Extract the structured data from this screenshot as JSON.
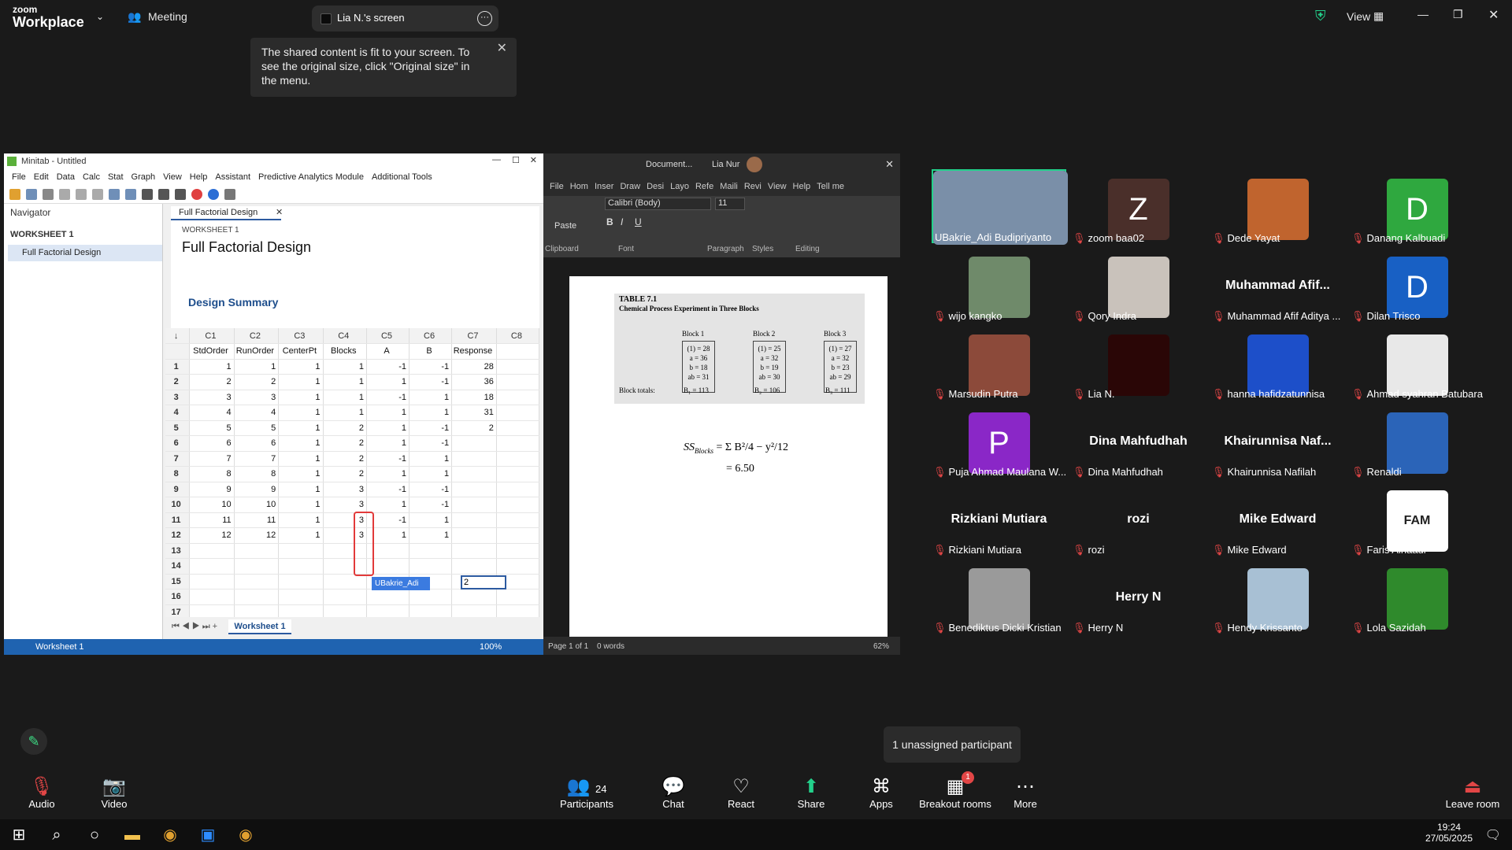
{
  "zoom": {
    "brand_top": "zoom",
    "brand": "Workplace",
    "meeting": "Meeting",
    "view": "View",
    "share_title": "Lia N.'s screen",
    "notice": "The shared content is fit to your screen. To see the original size, click \"Original size\" in the menu."
  },
  "minitab": {
    "title": "Minitab - Untitled",
    "menu": [
      "File",
      "Edit",
      "Data",
      "Calc",
      "Stat",
      "Graph",
      "View",
      "Help",
      "Assistant",
      "Predictive Analytics Module",
      "Additional Tools"
    ],
    "navigator": "Navigator",
    "worksheet_group": "WORKSHEET 1",
    "nav_item": "Full Factorial Design",
    "output_tab": "Full Factorial Design",
    "output_ws": "WORKSHEET 1",
    "output_title": "Full Factorial Design",
    "design_summary": "Design Summary",
    "col_ids": [
      "C1",
      "C2",
      "C3",
      "C4",
      "C5",
      "C6",
      "C7",
      "C8"
    ],
    "col_names": [
      "StdOrder",
      "RunOrder",
      "CenterPt",
      "Blocks",
      "A",
      "B",
      "Response",
      ""
    ],
    "rows": [
      [
        "1",
        "1",
        "1",
        "1",
        "-1",
        "-1",
        "28"
      ],
      [
        "2",
        "2",
        "1",
        "1",
        "1",
        "-1",
        "36"
      ],
      [
        "3",
        "3",
        "1",
        "1",
        "-1",
        "1",
        "18"
      ],
      [
        "4",
        "4",
        "1",
        "1",
        "1",
        "1",
        "31"
      ],
      [
        "5",
        "5",
        "1",
        "2",
        "1",
        "-1",
        "2"
      ],
      [
        "6",
        "6",
        "1",
        "2",
        "1",
        "-1",
        ""
      ],
      [
        "7",
        "7",
        "1",
        "2",
        "-1",
        "1",
        ""
      ],
      [
        "8",
        "8",
        "1",
        "2",
        "1",
        "1",
        ""
      ],
      [
        "9",
        "9",
        "1",
        "3",
        "-1",
        "-1",
        ""
      ],
      [
        "10",
        "10",
        "1",
        "3",
        "1",
        "-1",
        ""
      ],
      [
        "11",
        "11",
        "1",
        "3",
        "-1",
        "1",
        ""
      ],
      [
        "12",
        "12",
        "1",
        "3",
        "1",
        "1",
        ""
      ]
    ],
    "row_count": 17,
    "sheet_tab": "Worksheet 1",
    "status_ws": "Worksheet 1",
    "zoom": "100%",
    "annotation": "UBakrie_Adi B..."
  },
  "word": {
    "title": "Document...",
    "user": "Lia Nur",
    "tabs": [
      "File",
      "Hom",
      "Inser",
      "Draw",
      "Desi",
      "Layo",
      "Refe",
      "Maili",
      "Revi",
      "View",
      "Help",
      "Tell me"
    ],
    "font": "Calibri (Body)",
    "size": "11",
    "groups": [
      "Clipboard",
      "Font",
      "Paragraph",
      "Styles",
      "Editing"
    ],
    "paste": "Paste",
    "status_page": "Page 1 of 1",
    "status_words": "0 words",
    "zoom": "62%",
    "table_title": "TABLE 7.1",
    "table_sub": "Chemical Process Experiment in Three Blocks",
    "blocks": [
      {
        "h": "Block 1",
        "v": [
          "(1) = 28",
          "a = 36",
          "b = 18",
          "ab = 31"
        ],
        "t": "B₁ = 113"
      },
      {
        "h": "Block 2",
        "v": [
          "(1) = 25",
          "a = 32",
          "b = 19",
          "ab = 30"
        ],
        "t": "B₂ = 106"
      },
      {
        "h": "Block 3",
        "v": [
          "(1) = 27",
          "a = 32",
          "b = 23",
          "ab = 29"
        ],
        "t": "B₃ = 111"
      }
    ],
    "block_totals": "Block totals:",
    "formula_lhs": "SS",
    "formula_sub": "Blocks",
    "formula_result": "= 6.50"
  },
  "participants": [
    {
      "name": "UBakrie_Adi Budipriyanto",
      "type": "video",
      "color": "#7a8fa8",
      "speaker": true
    },
    {
      "name": "zoom baa02",
      "type": "letter",
      "letter": "Z",
      "color": "#4a2f2a"
    },
    {
      "name": "Dede Yayat",
      "type": "video",
      "color": "#c0642e"
    },
    {
      "name": "Danang Kalbuadi",
      "type": "letter",
      "letter": "D",
      "color": "#2fa83f"
    },
    {
      "name": "wijo kangko",
      "type": "video",
      "color": "#6f8a6a"
    },
    {
      "name": "Qory Indra",
      "type": "video",
      "color": "#c9c2bb"
    },
    {
      "name": "Muhammad Afif Aditya ...",
      "type": "text",
      "big": "Muhammad Afif..."
    },
    {
      "name": "Dilan Trisco",
      "type": "letter",
      "letter": "D",
      "color": "#1860c4"
    },
    {
      "name": "Marsudin Putra",
      "type": "video",
      "color": "#8c4a3a"
    },
    {
      "name": "Lia N.",
      "type": "video",
      "color": "#2a0606"
    },
    {
      "name": "hanna hafidzatunnisa",
      "type": "video",
      "color": "#1d4fc9"
    },
    {
      "name": "Ahmad syahran Batubara",
      "type": "video",
      "color": "#e8e8e8"
    },
    {
      "name": "Puja Ahmad Maulana W...",
      "type": "letter",
      "letter": "P",
      "color": "#8a27c7"
    },
    {
      "name": "Dina Mahfudhah",
      "type": "text",
      "big": "Dina Mahfudhah"
    },
    {
      "name": "Khairunnisa Nafilah",
      "type": "text",
      "big": "Khairunnisa Naf..."
    },
    {
      "name": "Renaldi",
      "type": "video",
      "color": "#2b64b8"
    },
    {
      "name": "Rizkiani Mutiara",
      "type": "text",
      "big": "Rizkiani Mutiara"
    },
    {
      "name": "rozi",
      "type": "text",
      "big": "rozi"
    },
    {
      "name": "Mike Edward",
      "type": "text",
      "big": "Mike Edward"
    },
    {
      "name": "Faris Alhaadi",
      "type": "video",
      "color": "#ffffff",
      "logo": "FAM"
    },
    {
      "name": "Benediktus Dicki Kristian",
      "type": "video",
      "color": "#9a9a9a"
    },
    {
      "name": "Herry N",
      "type": "text",
      "big": "Herry N"
    },
    {
      "name": "Hendy Krissanto",
      "type": "video",
      "color": "#a8c0d4"
    },
    {
      "name": "Lola Sazidah",
      "type": "letter",
      "letter": "",
      "color": "#2f8a2c"
    }
  ],
  "unassigned": "1 unassigned participant",
  "bottom": {
    "audio": "Audio",
    "video": "Video",
    "participants": "Participants",
    "participants_count": "24",
    "chat": "Chat",
    "react": "React",
    "share": "Share",
    "apps": "Apps",
    "breakout": "Breakout rooms",
    "breakout_badge": "1",
    "more": "More",
    "leave": "Leave room"
  },
  "taskbar": {
    "time": "19:24",
    "date": "27/05/2025"
  }
}
